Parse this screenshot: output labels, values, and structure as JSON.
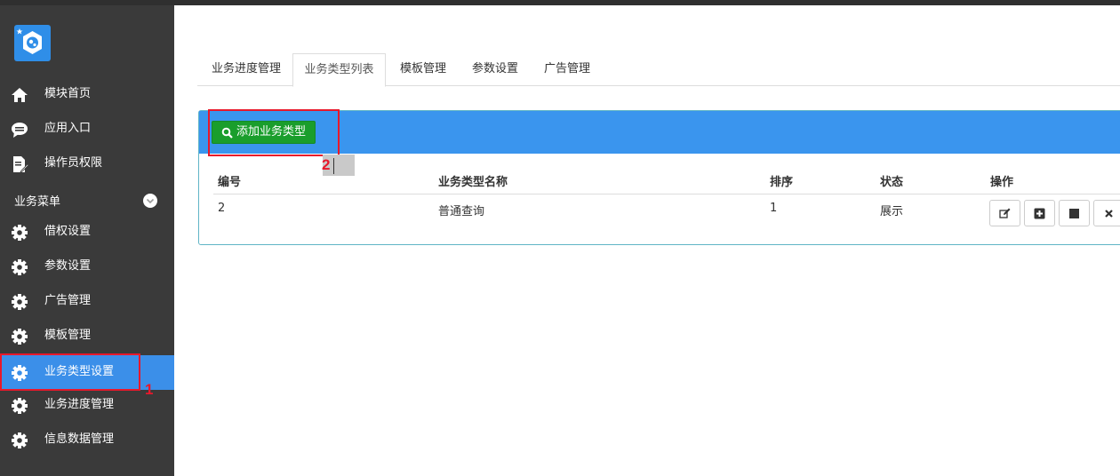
{
  "sidebar": {
    "items": [
      {
        "label": "模块首页",
        "icon": "home-icon"
      },
      {
        "label": "应用入口",
        "icon": "chat-bubble-icon"
      },
      {
        "label": "操作员权限",
        "icon": "document-edit-icon"
      }
    ],
    "section_title": "业务菜单",
    "section_icon": "chevron-down-icon",
    "menu_items": [
      {
        "label": "借权设置",
        "icon": "gear-icon"
      },
      {
        "label": "参数设置",
        "icon": "gear-icon"
      },
      {
        "label": "广告管理",
        "icon": "gear-icon"
      },
      {
        "label": "模板管理",
        "icon": "gear-icon"
      },
      {
        "label": "业务类型设置",
        "icon": "gear-icon",
        "active": true
      },
      {
        "label": "业务进度管理",
        "icon": "gear-icon"
      },
      {
        "label": "信息数据管理",
        "icon": "gear-icon"
      }
    ]
  },
  "annotations": {
    "marker_1": "1",
    "marker_2": "2"
  },
  "tabs": [
    {
      "label": "业务进度管理"
    },
    {
      "label": "业务类型列表",
      "active": true
    },
    {
      "label": "模板管理"
    },
    {
      "label": "参数设置"
    },
    {
      "label": "广告管理"
    }
  ],
  "panel": {
    "add_button": "添加业务类型",
    "add_button_icon": "search-icon"
  },
  "table": {
    "columns": [
      "编号",
      "业务类型名称",
      "排序",
      "状态",
      "操作"
    ],
    "rows": [
      {
        "id": "2",
        "name": "普通查询",
        "order": "1",
        "status": "展示"
      }
    ],
    "actions": [
      "edit-icon",
      "plus-square-icon",
      "stop-icon",
      "close-icon"
    ]
  },
  "colors": {
    "sidebar_bg": "#3a3a3a",
    "active_item": "#3b8fe9",
    "panel_head": "#3a95ee",
    "add_button": "#1a9e2c",
    "highlight": "#e8182b"
  }
}
